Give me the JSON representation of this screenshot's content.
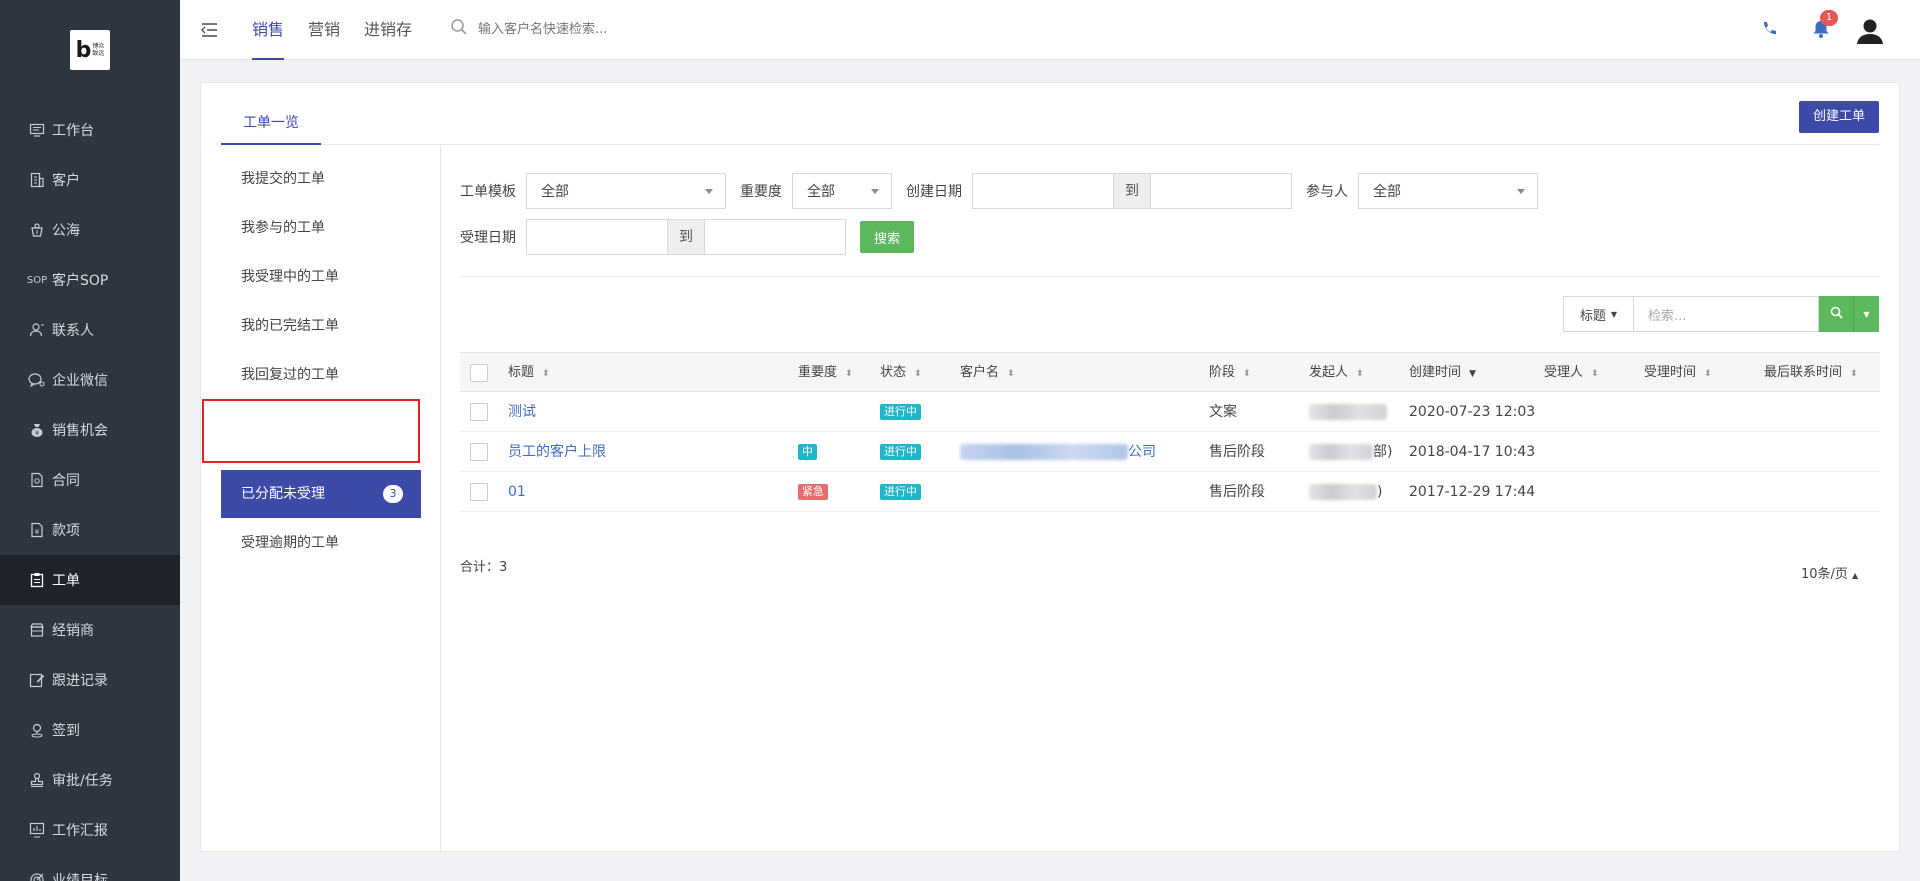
{
  "brand": {
    "logo_text": "博众\n致远"
  },
  "sidebar": {
    "items": [
      {
        "label": "工作台",
        "icon": "monitor-icon"
      },
      {
        "label": "客户",
        "icon": "building-icon"
      },
      {
        "label": "公海",
        "icon": "pool-icon"
      },
      {
        "label": "客户SOP",
        "icon": "sop-icon"
      },
      {
        "label": "联系人",
        "icon": "contact-icon"
      },
      {
        "label": "企业微信",
        "icon": "wechat-icon"
      },
      {
        "label": "销售机会",
        "icon": "moneybag-icon"
      },
      {
        "label": "合同",
        "icon": "contract-icon"
      },
      {
        "label": "款项",
        "icon": "payment-icon"
      },
      {
        "label": "工单",
        "icon": "clipboard-icon",
        "active": true
      },
      {
        "label": "经销商",
        "icon": "store-icon"
      },
      {
        "label": "跟进记录",
        "icon": "edit-icon"
      },
      {
        "label": "签到",
        "icon": "location-icon"
      },
      {
        "label": "审批/任务",
        "icon": "stamp-icon"
      },
      {
        "label": "工作汇报",
        "icon": "report-icon"
      },
      {
        "label": "业绩目标",
        "icon": "target-icon"
      }
    ]
  },
  "topbar": {
    "tabs": [
      "销售",
      "营销",
      "进销存"
    ],
    "active_tab": "销售",
    "search_placeholder": "输入客户名快速检索...",
    "notification_count": "1"
  },
  "page": {
    "tab": "工单一览",
    "create_button": "创建工单"
  },
  "left_list": {
    "items": [
      {
        "label": "我提交的工单"
      },
      {
        "label": "我参与的工单"
      },
      {
        "label": "我受理中的工单"
      },
      {
        "label": "我的已完结工单"
      },
      {
        "label": "我回复过的工单"
      },
      {
        "label": "已分配未受理",
        "count": "3",
        "active": true
      },
      {
        "label": "受理逾期的工单"
      }
    ]
  },
  "filters": {
    "template_label": "工单模板",
    "template_value": "全部",
    "importance_label": "重要度",
    "importance_value": "全部",
    "created_label": "创建日期",
    "to_label": "到",
    "participant_label": "参与人",
    "participant_value": "全部",
    "accepted_label": "受理日期",
    "search_button": "搜索"
  },
  "table_search": {
    "field": "标题",
    "placeholder": "检索..."
  },
  "table": {
    "columns": [
      "标题",
      "重要度",
      "状态",
      "客户名",
      "阶段",
      "发起人",
      "创建时间",
      "受理人",
      "受理时间",
      "最后联系时间"
    ],
    "rows": [
      {
        "title": "测试",
        "importance": "",
        "status": "进行中",
        "customer": "",
        "stage": "文案",
        "initiator": "(                )",
        "created": "2020-07-23 12:03",
        "assignee": "",
        "accepted": "",
        "last_contact": ""
      },
      {
        "title": "员工的客户上限",
        "importance": "中",
        "status": "进行中",
        "customer": "公司",
        "stage": "售后阶段",
        "initiator": "部)",
        "created": "2018-04-17 10:43",
        "assignee": "",
        "accepted": "",
        "last_contact": ""
      },
      {
        "title": "01",
        "importance": "紧急",
        "status": "进行中",
        "customer": "",
        "stage": "售后阶段",
        "initiator": ")",
        "created": "2017-12-29 17:44",
        "assignee": "",
        "accepted": "",
        "last_contact": ""
      }
    ]
  },
  "footer": {
    "total": "合计：3",
    "page_size": "10条/页"
  }
}
